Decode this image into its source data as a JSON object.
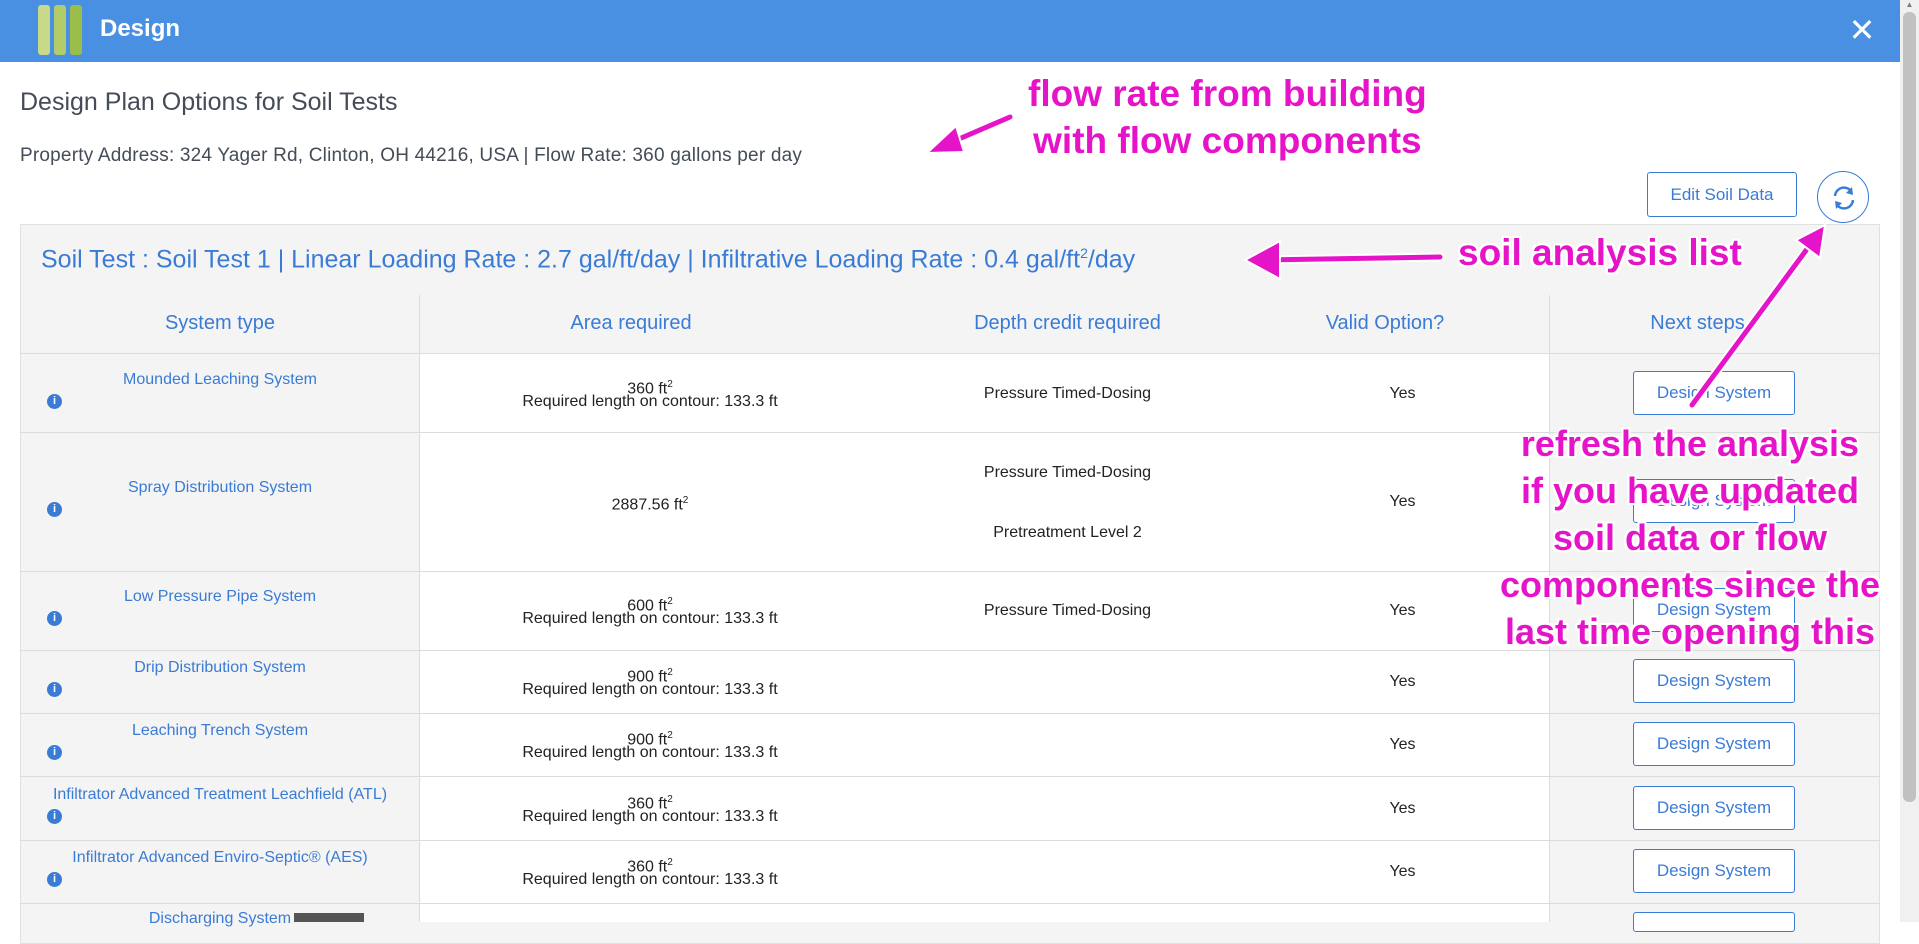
{
  "header": {
    "title": "Design",
    "close_label": "✕"
  },
  "page": {
    "title": "Design Plan Options for Soil Tests",
    "address_line": "Property Address: 324 Yager Rd, Clinton, OH 44216, USA | Flow Rate: 360 gallons per day",
    "edit_soil_label": "Edit Soil Data"
  },
  "soil_test": {
    "heading_main": "Soil Test : Soil Test 1 | Linear Loading Rate : 2.7  gal/ft/day | Infiltrative Loading Rate : 0.4  gal/ft",
    "heading_sup": "2",
    "heading_tail": "/day"
  },
  "table": {
    "headers": [
      "System type",
      "Area required",
      "Depth credit required",
      "Valid Option?",
      "Next steps"
    ],
    "rows": [
      {
        "name": "Mounded Leaching System",
        "area": "360 ft",
        "length": "Required length on contour: 133.3 ft",
        "depth": "Pressure Timed-Dosing",
        "depth2": "",
        "valid": "Yes",
        "button": "Design System"
      },
      {
        "name": "Spray Distribution System",
        "area": "2887.56 ft",
        "length": "",
        "depth": "Pressure Timed-Dosing",
        "depth2": "Pretreatment Level 2",
        "valid": "Yes",
        "button": "Design System"
      },
      {
        "name": "Low Pressure Pipe System",
        "area": "600 ft",
        "length": "Required length on contour: 133.3 ft",
        "depth": "Pressure Timed-Dosing",
        "depth2": "",
        "valid": "Yes",
        "button": "Design System"
      },
      {
        "name": "Drip Distribution System",
        "area": "900 ft",
        "length": "Required length on contour: 133.3 ft",
        "depth": "",
        "depth2": "",
        "valid": "Yes",
        "button": "Design System"
      },
      {
        "name": "Leaching Trench System",
        "area": "900 ft",
        "length": "Required length on contour: 133.3 ft",
        "depth": "",
        "depth2": "",
        "valid": "Yes",
        "button": "Design System"
      },
      {
        "name": "Infiltrator Advanced Treatment Leachfield (ATL)",
        "area": "360 ft",
        "length": "Required length on contour: 133.3 ft",
        "depth": "",
        "depth2": "",
        "valid": "Yes",
        "button": "Design System"
      },
      {
        "name": "Infiltrator Advanced Enviro-Septic® (AES)",
        "area": "360 ft",
        "length": "Required length on contour: 133.3 ft",
        "depth": "",
        "depth2": "",
        "valid": "Yes",
        "button": "Design System"
      },
      {
        "name": "Discharging System",
        "area": "",
        "length": "",
        "depth": "",
        "depth2": "",
        "valid": "",
        "button": ""
      }
    ],
    "area_unit_sup": "2"
  },
  "annotations": {
    "flow_line1": "flow rate from building",
    "flow_line2": "with flow components",
    "soil_list": "soil analysis list",
    "refresh_1": "refresh the analysis",
    "refresh_2": "if you have updated",
    "refresh_3": "soil data or flow",
    "refresh_4": "components since the",
    "refresh_5": "last time opening this"
  },
  "colors": {
    "header_bg": "#4a90e2",
    "accent": "#3a7bd5",
    "annotation": "#e614c8",
    "logo_green_1": "#c8d98a",
    "logo_green_2": "#9bbd4a"
  },
  "icons": {
    "close": "close-icon",
    "refresh": "refresh-icon",
    "info": "info-icon",
    "logo": "logo-icon"
  }
}
